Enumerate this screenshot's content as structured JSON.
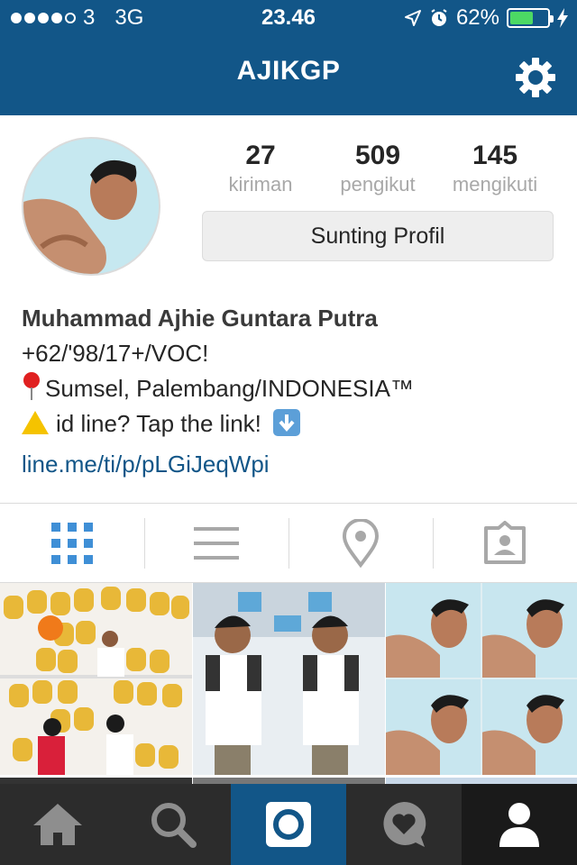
{
  "status_bar": {
    "carrier": "3",
    "network": "3G",
    "time": "23.46",
    "battery_percent": "62%",
    "battery_level": 0.62
  },
  "header": {
    "title": "AJIKGP",
    "settings_icon": "gear-icon"
  },
  "profile": {
    "stats": [
      {
        "value": "27",
        "label": "kiriman"
      },
      {
        "value": "509",
        "label": "pengikut"
      },
      {
        "value": "145",
        "label": "mengikuti"
      }
    ],
    "edit_button_label": "Sunting Profil",
    "bio": {
      "name": "Muhammad Ajhie Guntara Putra",
      "line1": "+62/'98/17+/VOC!",
      "line2": "Sumsel, Palembang/INDONESIA™",
      "line3": "id line? Tap the link!",
      "link": "line.me/ti/p/pLGiJeqWpi"
    }
  },
  "view_tabs": [
    {
      "name": "grid-view",
      "icon": "grid-icon"
    },
    {
      "name": "list-view",
      "icon": "list-icon"
    },
    {
      "name": "location-view",
      "icon": "location-pin-icon"
    },
    {
      "name": "tagged-view",
      "icon": "tagged-person-icon"
    }
  ],
  "bottom_nav": [
    {
      "name": "home",
      "icon": "home-icon"
    },
    {
      "name": "explore",
      "icon": "search-icon"
    },
    {
      "name": "camera",
      "icon": "camera-icon"
    },
    {
      "name": "activity",
      "icon": "heart-bubble-icon"
    },
    {
      "name": "profile",
      "icon": "person-icon"
    }
  ],
  "colors": {
    "brand": "#125688",
    "link": "#125688",
    "active_tab": "#3f8fd6",
    "bottom_bar": "#2c2c2c"
  }
}
